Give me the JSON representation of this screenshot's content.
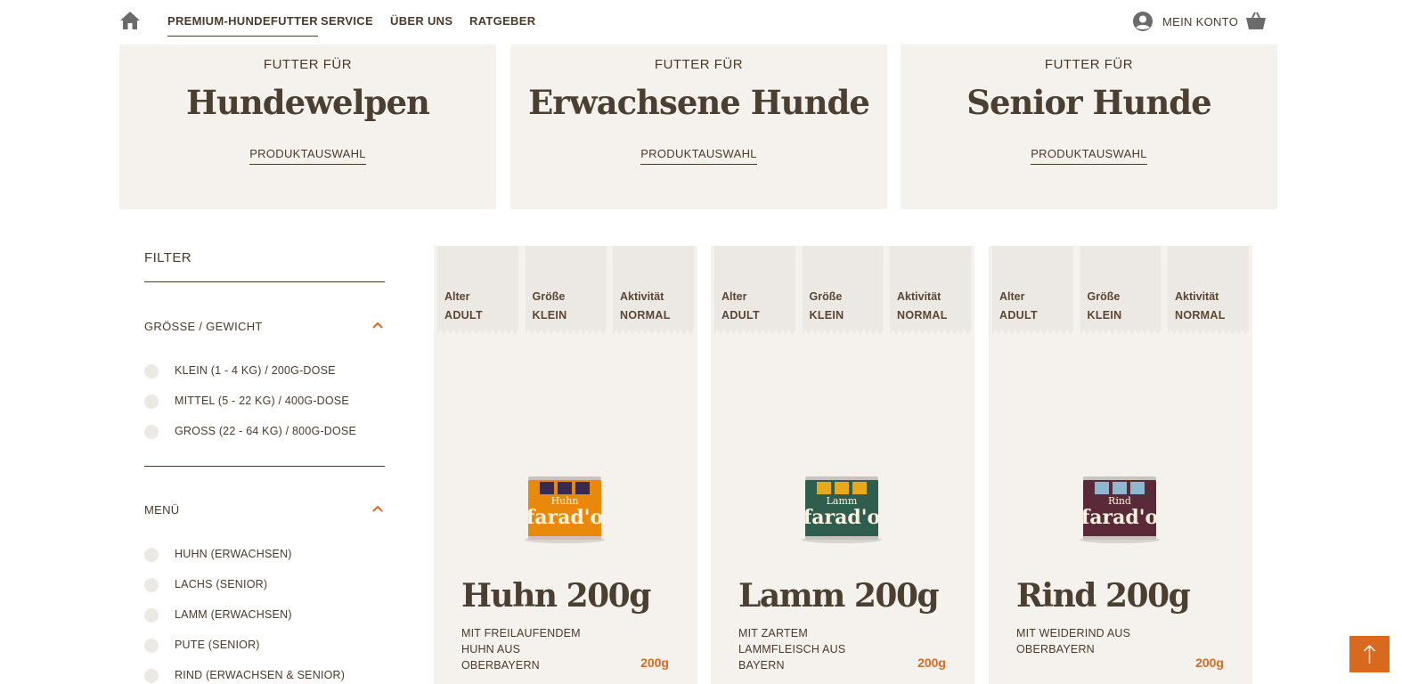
{
  "nav": {
    "items": [
      "PREMIUM-HUNDEFUTTER",
      "SERVICE",
      "ÜBER UNS",
      "RATGEBER"
    ],
    "account_label": "MEIN KONTO",
    "icons": [
      "home-icon",
      "user-icon",
      "basket-icon"
    ]
  },
  "categories": [
    {
      "pre": "FUTTER FÜR",
      "title": "Hundewelpen",
      "link": "PRODUKTAUSWAHL"
    },
    {
      "pre": "FUTTER FÜR",
      "title": "Erwachsene Hunde",
      "link": "PRODUKTAUSWAHL"
    },
    {
      "pre": "FUTTER FÜR",
      "title": "Senior Hunde",
      "link": "PRODUKTAUSWAHL"
    }
  ],
  "filter": {
    "title": "FILTER",
    "groups": [
      {
        "label": "GRÖSSE / GEWICHT",
        "options": [
          "KLEIN (1 - 4 KG) / 200G-DOSE",
          "MITTEL (5 - 22 KG) / 400G-DOSE",
          "GROSS (22 - 64 KG) / 800G-DOSE"
        ]
      },
      {
        "label": "MENÜ",
        "options": [
          "HUHN (ERWACHSEN)",
          "LACHS (SENIOR)",
          "LAMM (ERWACHSEN)",
          "PUTE (SENIOR)",
          "RIND (ERWACHSEN & SENIOR)"
        ]
      }
    ]
  },
  "products": [
    {
      "tags": [
        {
          "k": "Alter",
          "v": "ADULT"
        },
        {
          "k": "Größe",
          "v": "KLEIN"
        },
        {
          "k": "Aktivität",
          "v": "NORMAL"
        }
      ],
      "can_label": "Huhn",
      "can_brand": "farad'o",
      "can_color": "#e8890c",
      "name": "Huhn 200g",
      "desc": "MIT FREILAUFENDEM HUHN AUS OBERBAYERN",
      "weight": "200g"
    },
    {
      "tags": [
        {
          "k": "Alter",
          "v": "ADULT"
        },
        {
          "k": "Größe",
          "v": "KLEIN"
        },
        {
          "k": "Aktivität",
          "v": "NORMAL"
        }
      ],
      "can_label": "Lamm",
      "can_brand": "farad'o",
      "can_color": "#2f5e4e",
      "name": "Lamm 200g",
      "desc": "MIT ZARTEM LAMMFLEISCH AUS BAYERN",
      "weight": "200g"
    },
    {
      "tags": [
        {
          "k": "Alter",
          "v": "ADULT"
        },
        {
          "k": "Größe",
          "v": "KLEIN"
        },
        {
          "k": "Aktivität",
          "v": "NORMAL"
        }
      ],
      "can_label": "Rind",
      "can_brand": "farad'o",
      "can_color": "#5a2a38",
      "name": "Rind 200g",
      "desc": "MIT WEIDERIND AUS OBERBAYERN",
      "weight": "200g"
    }
  ],
  "colors": {
    "accent": "#d9691e",
    "card_bg": "#f5f2ed",
    "text": "#4a3a2a"
  }
}
